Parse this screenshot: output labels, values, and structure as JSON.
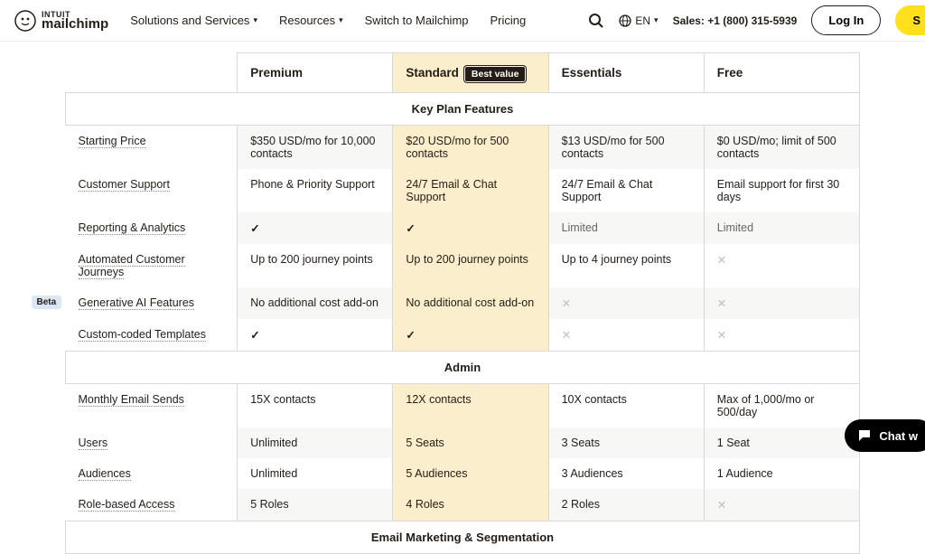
{
  "brand": {
    "intuit": "INTUIT",
    "mailchimp": "mailchimp"
  },
  "nav": {
    "solutions": "Solutions and Services",
    "resources": "Resources",
    "switch": "Switch to Mailchimp",
    "pricing": "Pricing"
  },
  "header": {
    "lang": "EN",
    "sales": "Sales: +1 (800) 315-5939",
    "login": "Log In",
    "signup": "S"
  },
  "plans": {
    "premium": "Premium",
    "standard": "Standard",
    "badge": "Best value",
    "essentials": "Essentials",
    "free": "Free"
  },
  "sections": {
    "key": "Key Plan Features",
    "admin": "Admin",
    "seg": "Email Marketing & Segmentation"
  },
  "rows": {
    "starting": {
      "label": "Starting Price",
      "p": "$350 USD/mo for 10,000 contacts",
      "s": "$20 USD/mo for 500 contacts",
      "e": "$13 USD/mo for 500 contacts",
      "f": "$0 USD/mo; limit of 500 contacts"
    },
    "support": {
      "label": "Customer Support",
      "p": "Phone & Priority Support",
      "s": "24/7 Email & Chat Support",
      "e": "24/7 Email & Chat Support",
      "f": "Email support for first 30 days"
    },
    "reporting": {
      "label": "Reporting & Analytics",
      "e": "Limited",
      "f": "Limited"
    },
    "journeys": {
      "label": "Automated Customer Journeys",
      "p": "Up to 200 journey points",
      "s": "Up to 200 journey points",
      "e": "Up to 4 journey points"
    },
    "genai": {
      "label": "Generative AI Features",
      "beta": "Beta",
      "p": "No additional cost add-on",
      "s": "No additional cost add-on"
    },
    "templates": {
      "label": "Custom-coded Templates"
    },
    "sends": {
      "label": "Monthly Email Sends",
      "p": "15X contacts",
      "s": "12X contacts",
      "e": "10X contacts",
      "f": "Max of 1,000/mo or 500/day"
    },
    "users": {
      "label": "Users",
      "p": "Unlimited",
      "s": "5 Seats",
      "e": "3 Seats",
      "f": "1 Seat"
    },
    "audiences": {
      "label": "Audiences",
      "p": "Unlimited",
      "s": "5 Audiences",
      "e": "3 Audiences",
      "f": "1 Audience"
    },
    "roles": {
      "label": "Role-based Access",
      "p": "5 Roles",
      "s": "4 Roles",
      "e": "2 Roles"
    }
  },
  "chat": "Chat w"
}
